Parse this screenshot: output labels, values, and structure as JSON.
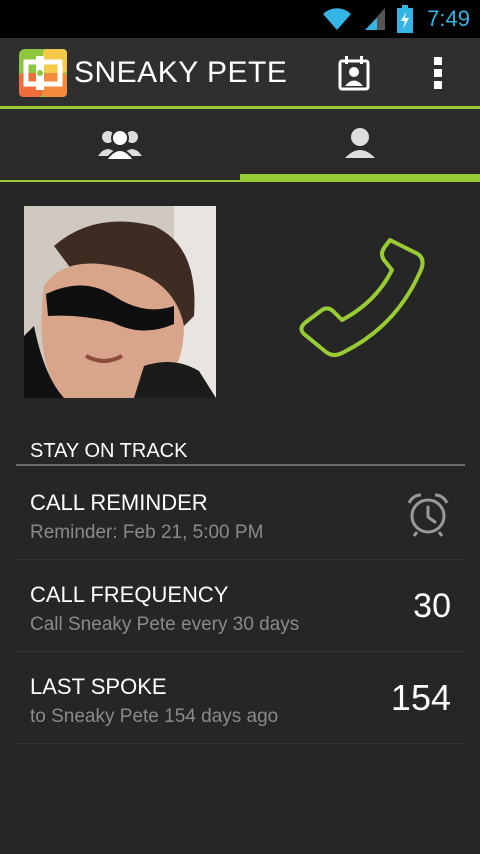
{
  "status_bar": {
    "time": "7:49",
    "icons": [
      "wifi-icon",
      "signal-icon",
      "battery-charging-icon"
    ],
    "accent_color": "#33b5e5"
  },
  "action_bar": {
    "title": "SNEAKY PETE",
    "actions": [
      "calendar-contact-icon",
      "overflow-menu-icon"
    ]
  },
  "tabs": [
    {
      "icon": "group-icon",
      "selected": false
    },
    {
      "icon": "person-icon",
      "selected": true
    }
  ],
  "accent_color": "#99cc33",
  "contact": {
    "photo": "contact-photo",
    "call_icon": "phone-icon"
  },
  "section": {
    "header": "STAY ON TRACK"
  },
  "rows": [
    {
      "title": "CALL REMINDER",
      "subtitle": "Reminder: Feb 21, 5:00 PM",
      "icon": "alarm-clock-icon"
    },
    {
      "title": "CALL FREQUENCY",
      "subtitle": "Call Sneaky Pete every 30 days",
      "value": "30"
    },
    {
      "title": "LAST SPOKE",
      "subtitle": "to Sneaky Pete 154 days ago",
      "value": "154"
    }
  ]
}
